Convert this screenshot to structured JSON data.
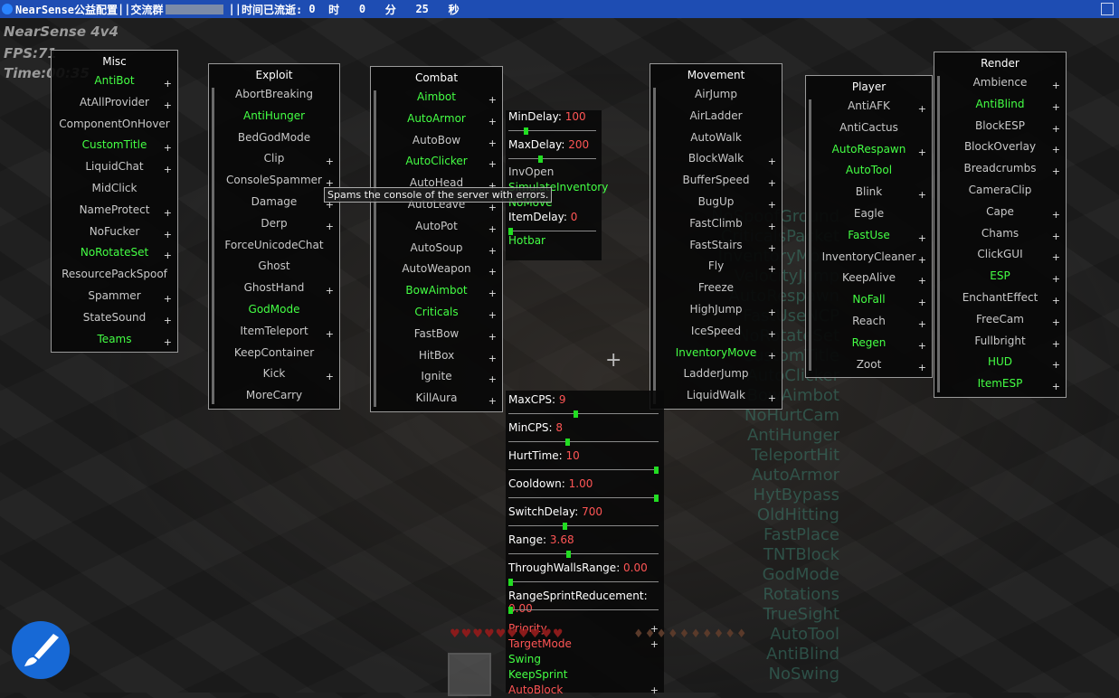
{
  "titlebar": {
    "app": "NearSense公益配置",
    "sep1": " || ",
    "group_label": "交流群",
    "sep2": "|| ",
    "timer_label": "时间已流逝:",
    "hours": "0",
    "hours_unit": "时",
    "minutes": "0",
    "minutes_unit": "分",
    "seconds": "25",
    "seconds_unit": "秒"
  },
  "hud": {
    "client": "NearSense 4v4",
    "fps": "FPS:71",
    "time": "Time:00:35"
  },
  "tooltip": "Spams the console of the server with errors.",
  "panels": {
    "misc": {
      "title": "Misc",
      "items": [
        {
          "label": "AntiBot",
          "on": true,
          "plus": true
        },
        {
          "label": "AtAllProvider",
          "on": false,
          "plus": true
        },
        {
          "label": "ComponentOnHover",
          "on": false,
          "plus": false
        },
        {
          "label": "CustomTitle",
          "on": true,
          "plus": true
        },
        {
          "label": "LiquidChat",
          "on": false,
          "plus": true
        },
        {
          "label": "MidClick",
          "on": false,
          "plus": false
        },
        {
          "label": "NameProtect",
          "on": false,
          "plus": true
        },
        {
          "label": "NoFucker",
          "on": false,
          "plus": true
        },
        {
          "label": "NoRotateSet",
          "on": true,
          "plus": true
        },
        {
          "label": "ResourcePackSpoof",
          "on": false,
          "plus": false
        },
        {
          "label": "Spammer",
          "on": false,
          "plus": true
        },
        {
          "label": "StateSound",
          "on": false,
          "plus": true
        },
        {
          "label": "Teams",
          "on": true,
          "plus": true
        }
      ]
    },
    "exploit": {
      "title": "Exploit",
      "items": [
        {
          "label": "AbortBreaking",
          "on": false,
          "plus": false
        },
        {
          "label": "AntiHunger",
          "on": true,
          "plus": false
        },
        {
          "label": "BedGodMode",
          "on": false,
          "plus": false
        },
        {
          "label": "Clip",
          "on": false,
          "plus": true
        },
        {
          "label": "ConsoleSpammer",
          "on": false,
          "plus": true
        },
        {
          "label": "Damage",
          "on": false,
          "plus": true
        },
        {
          "label": "Derp",
          "on": false,
          "plus": true
        },
        {
          "label": "ForceUnicodeChat",
          "on": false,
          "plus": false
        },
        {
          "label": "Ghost",
          "on": false,
          "plus": false
        },
        {
          "label": "GhostHand",
          "on": false,
          "plus": true
        },
        {
          "label": "GodMode",
          "on": true,
          "plus": false
        },
        {
          "label": "ItemTeleport",
          "on": false,
          "plus": true
        },
        {
          "label": "KeepContainer",
          "on": false,
          "plus": false
        },
        {
          "label": "Kick",
          "on": false,
          "plus": true
        },
        {
          "label": "MoreCarry",
          "on": false,
          "plus": false
        }
      ]
    },
    "combat": {
      "title": "Combat",
      "items": [
        {
          "label": "Aimbot",
          "on": true,
          "plus": true
        },
        {
          "label": "AutoArmor",
          "on": true,
          "plus": true
        },
        {
          "label": "AutoBow",
          "on": false,
          "plus": true
        },
        {
          "label": "AutoClicker",
          "on": true,
          "plus": true
        },
        {
          "label": "AutoHead",
          "on": false,
          "plus": true
        },
        {
          "label": "AutoLeave",
          "on": false,
          "plus": true
        },
        {
          "label": "AutoPot",
          "on": false,
          "plus": true
        },
        {
          "label": "AutoSoup",
          "on": false,
          "plus": true
        },
        {
          "label": "AutoWeapon",
          "on": false,
          "plus": true
        },
        {
          "label": "BowAimbot",
          "on": true,
          "plus": true
        },
        {
          "label": "Criticals",
          "on": true,
          "plus": true
        },
        {
          "label": "FastBow",
          "on": false,
          "plus": true
        },
        {
          "label": "HitBox",
          "on": false,
          "plus": true
        },
        {
          "label": "Ignite",
          "on": false,
          "plus": true
        },
        {
          "label": "KillAura",
          "on": false,
          "plus": true
        }
      ]
    },
    "movement": {
      "title": "Movement",
      "items": [
        {
          "label": "AirJump",
          "on": false,
          "plus": false
        },
        {
          "label": "AirLadder",
          "on": false,
          "plus": false
        },
        {
          "label": "AutoWalk",
          "on": false,
          "plus": false
        },
        {
          "label": "BlockWalk",
          "on": false,
          "plus": true
        },
        {
          "label": "BufferSpeed",
          "on": false,
          "plus": true
        },
        {
          "label": "BugUp",
          "on": false,
          "plus": true
        },
        {
          "label": "FastClimb",
          "on": false,
          "plus": true
        },
        {
          "label": "FastStairs",
          "on": false,
          "plus": true
        },
        {
          "label": "Fly",
          "on": false,
          "plus": true
        },
        {
          "label": "Freeze",
          "on": false,
          "plus": false
        },
        {
          "label": "HighJump",
          "on": false,
          "plus": true
        },
        {
          "label": "IceSpeed",
          "on": false,
          "plus": true
        },
        {
          "label": "InventoryMove",
          "on": true,
          "plus": true
        },
        {
          "label": "LadderJump",
          "on": false,
          "plus": false
        },
        {
          "label": "LiquidWalk",
          "on": false,
          "plus": true
        }
      ]
    },
    "player": {
      "title": "Player",
      "items": [
        {
          "label": "AntiAFK",
          "on": false,
          "plus": true
        },
        {
          "label": "AntiCactus",
          "on": false,
          "plus": false
        },
        {
          "label": "AutoRespawn",
          "on": true,
          "plus": true
        },
        {
          "label": "AutoTool",
          "on": true,
          "plus": false
        },
        {
          "label": "Blink",
          "on": false,
          "plus": true
        },
        {
          "label": "Eagle",
          "on": false,
          "plus": false
        },
        {
          "label": "FastUse",
          "on": true,
          "plus": true
        },
        {
          "label": "InventoryCleaner",
          "on": false,
          "plus": true
        },
        {
          "label": "KeepAlive",
          "on": false,
          "plus": true
        },
        {
          "label": "NoFall",
          "on": true,
          "plus": true
        },
        {
          "label": "Reach",
          "on": false,
          "plus": true
        },
        {
          "label": "Regen",
          "on": true,
          "plus": true
        },
        {
          "label": "Zoot",
          "on": false,
          "plus": true
        }
      ]
    },
    "render": {
      "title": "Render",
      "items": [
        {
          "label": "Ambience",
          "on": false,
          "plus": true
        },
        {
          "label": "AntiBlind",
          "on": true,
          "plus": true
        },
        {
          "label": "BlockESP",
          "on": false,
          "plus": true
        },
        {
          "label": "BlockOverlay",
          "on": false,
          "plus": true
        },
        {
          "label": "Breadcrumbs",
          "on": false,
          "plus": true
        },
        {
          "label": "CameraClip",
          "on": false,
          "plus": false
        },
        {
          "label": "Cape",
          "on": false,
          "plus": true
        },
        {
          "label": "Chams",
          "on": false,
          "plus": true
        },
        {
          "label": "ClickGUI",
          "on": false,
          "plus": true
        },
        {
          "label": "ESP",
          "on": true,
          "plus": true
        },
        {
          "label": "EnchantEffect",
          "on": false,
          "plus": true
        },
        {
          "label": "FreeCam",
          "on": false,
          "plus": true
        },
        {
          "label": "Fullbright",
          "on": false,
          "plus": true
        },
        {
          "label": "HUD",
          "on": true,
          "plus": true
        },
        {
          "label": "ItemESP",
          "on": true,
          "plus": true
        }
      ]
    }
  },
  "autoclicker_settings": {
    "sliders": [
      {
        "name": "MinDelay",
        "value": "100",
        "fraction": 0.18
      },
      {
        "name": "MaxDelay",
        "value": "200",
        "fraction": 0.36
      }
    ],
    "options": [
      {
        "label": "InvOpen",
        "on": false
      },
      {
        "label": "SimulateInventory",
        "on": true
      },
      {
        "label": "NoMove",
        "on": true
      }
    ],
    "item_delay": {
      "name": "ItemDelay",
      "value": "0",
      "fraction": 0.0
    },
    "hotbar": {
      "label": "Hotbar",
      "on": true
    }
  },
  "killaura_settings": {
    "sliders": [
      {
        "name": "MaxCPS",
        "value": "9",
        "fraction": 0.45
      },
      {
        "name": "MinCPS",
        "value": "8",
        "fraction": 0.39
      },
      {
        "name": "HurtTime",
        "value": "10",
        "fraction": 1.0
      },
      {
        "name": "Cooldown",
        "value": "1.00",
        "fraction": 1.0
      },
      {
        "name": "SwitchDelay",
        "value": "700",
        "fraction": 0.37
      },
      {
        "name": "Range",
        "value": "3.68",
        "fraction": 0.4
      },
      {
        "name": "ThroughWallsRange",
        "value": "0.00",
        "fraction": 0.0
      },
      {
        "name": "RangeSprintReducement",
        "value": "0.00",
        "fraction": 0.0
      }
    ],
    "options": [
      {
        "label": "Priority",
        "color": "#ff5555",
        "plus": true
      },
      {
        "label": "TargetMode",
        "color": "#ff5555",
        "plus": true
      },
      {
        "label": "Swing",
        "color": "#44ff44",
        "plus": false
      },
      {
        "label": "KeepSprint",
        "color": "#44ff44",
        "plus": false
      },
      {
        "label": "AutoBlock",
        "color": "#ff5555",
        "plus": true
      }
    ]
  },
  "arraylist": [
    "NoSpoofGround",
    "CriticalsPacket",
    "InventoryMove",
    "VelocityJump",
    "AutoRespawn",
    "FastUseNCP",
    "NoRotateSet",
    "CustomTitle",
    "AutoClicker",
    "BowAimbot",
    "NoHurtCam",
    "AntiHunger",
    "TeleportHit",
    "AutoArmor",
    "HytBypass",
    "OldHitting",
    "FastPlace",
    "TNTBlock",
    "GodMode",
    "Rotations",
    "TrueSight",
    "AutoTool",
    "AntiBlind",
    "NoSwing"
  ],
  "colors": {
    "enabled": "#44ff44",
    "disabled": "#c8c8c8",
    "value": "#ff5555",
    "titlebar": "#1e4db3",
    "knob": "#22dd22"
  },
  "icons": {
    "crosshair": "plus-glyph",
    "paint": "paintbrush-icon"
  }
}
